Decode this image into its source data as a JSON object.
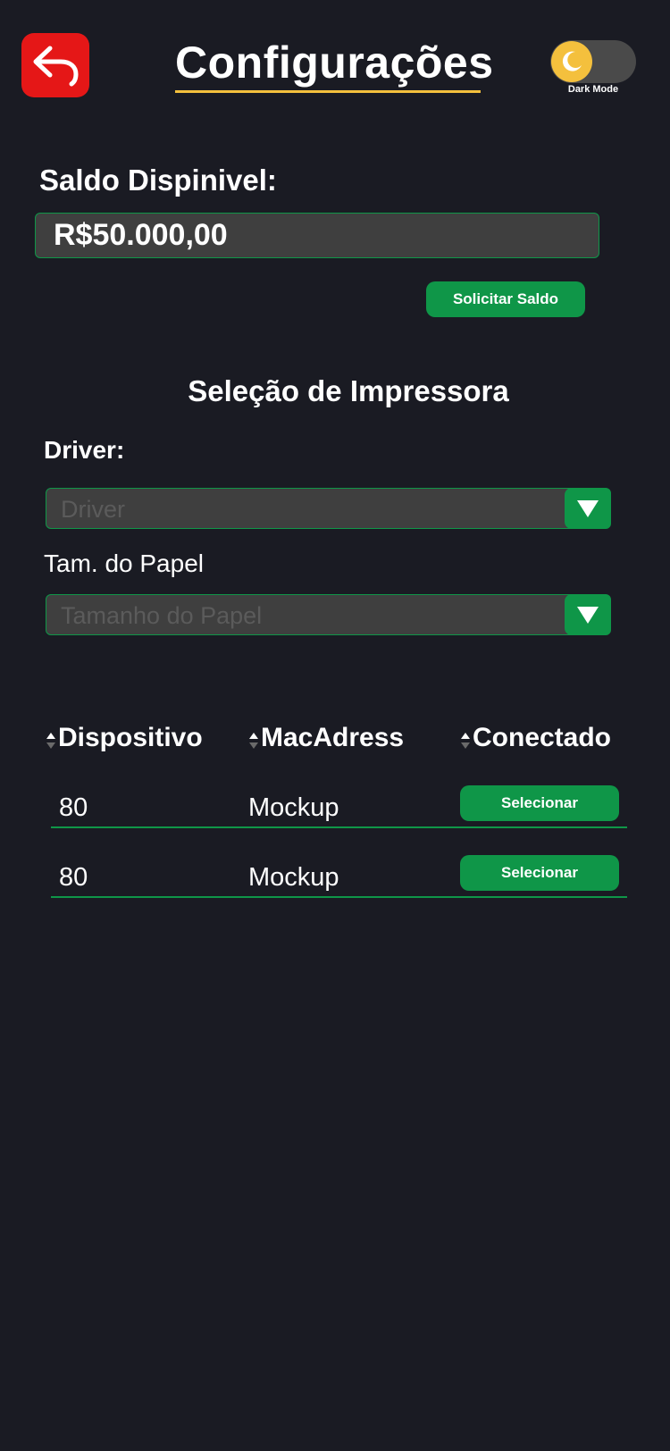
{
  "header": {
    "title": "Configurações",
    "dark_mode_label": "Dark Mode",
    "dark_mode_on": true
  },
  "balance": {
    "label": "Saldo Dispinivel:",
    "value": "R$50.000,00",
    "request_button": "Solicitar Saldo"
  },
  "printer": {
    "section_title": "Seleção de Impressora",
    "driver_label": "Driver:",
    "driver_placeholder": "Driver",
    "paper_label": "Tam. do Papel",
    "paper_placeholder": "Tamanho do Papel"
  },
  "devices": {
    "columns": [
      "Dispositivo",
      "MacAdress",
      "Conectado"
    ],
    "rows": [
      {
        "device": "80",
        "mac": "Mockup",
        "action": "Selecionar"
      },
      {
        "device": "80",
        "mac": "Mockup",
        "action": "Selecionar"
      }
    ]
  },
  "colors": {
    "background": "#1a1b23",
    "accent_green": "#0f9648",
    "back_button_red": "#e51717",
    "title_underline": "#f4c03d",
    "field_background": "#3f3f3f"
  }
}
